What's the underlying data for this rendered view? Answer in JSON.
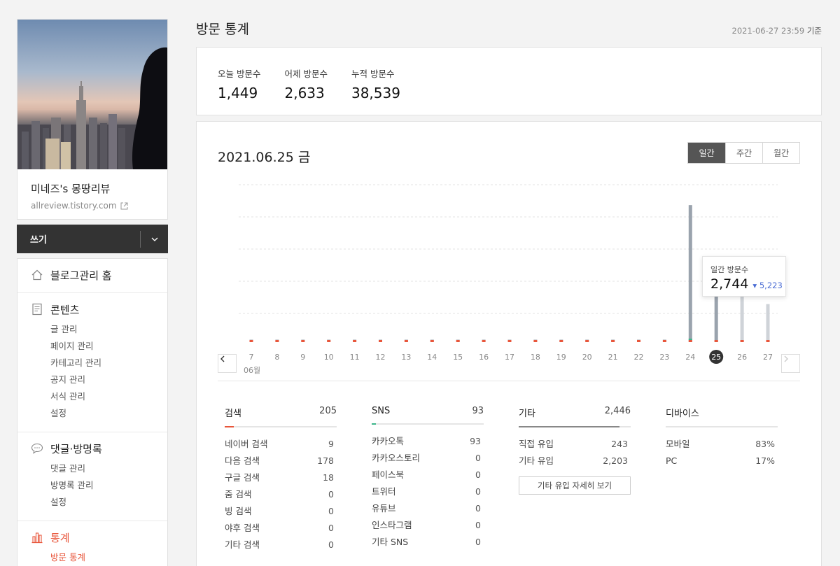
{
  "sidebar": {
    "blog_name": "미네즈's 몽땅리뷰",
    "blog_url": "allreview.tistory.com",
    "write_label": "쓰기",
    "groups": [
      {
        "title": "블로그관리 홈",
        "icon": "home-icon",
        "items": []
      },
      {
        "title": "콘텐츠",
        "icon": "document-icon",
        "items": [
          "글 관리",
          "페이지 관리",
          "카테고리 관리",
          "공지 관리",
          "서식 관리",
          "설정"
        ]
      },
      {
        "title": "댓글·방명록",
        "icon": "speech-bubble-icon",
        "items": [
          "댓글 관리",
          "방명록 관리",
          "설정"
        ]
      },
      {
        "title": "통계",
        "icon": "bar-chart-icon",
        "items": [
          "방문 통계"
        ]
      }
    ]
  },
  "header": {
    "title": "방문 통계",
    "timestamp": "2021-06-27 23:59",
    "timestamp_suffix": "기준"
  },
  "summary": [
    {
      "label": "오늘 방문수",
      "value": "1,449"
    },
    {
      "label": "어제 방문수",
      "value": "2,633"
    },
    {
      "label": "누적 방문수",
      "value": "38,539"
    }
  ],
  "panel": {
    "date": "2021.06.25 금",
    "toggle": [
      "일간",
      "주간",
      "월간"
    ],
    "month_label": "06월",
    "tooltip": {
      "label": "일간 방문수",
      "value": "2,744",
      "change": "5,223"
    }
  },
  "chart_data": {
    "type": "bar",
    "categories": [
      "7",
      "8",
      "9",
      "10",
      "11",
      "12",
      "13",
      "14",
      "15",
      "16",
      "17",
      "18",
      "19",
      "20",
      "21",
      "22",
      "23",
      "24",
      "25",
      "26",
      "27"
    ],
    "values": [
      55,
      40,
      30,
      30,
      30,
      25,
      30,
      35,
      40,
      25,
      30,
      45,
      35,
      45,
      50,
      45,
      45,
      5223,
      2744,
      2633,
      1449
    ],
    "selected": "25",
    "ylim": [
      0,
      6000
    ],
    "grid": true
  },
  "sources": [
    {
      "title": "검색",
      "total": "205",
      "accent": "#e8563b",
      "accent_fraction": 0.08,
      "rows": [
        [
          "네이버 검색",
          "9"
        ],
        [
          "다음 검색",
          "178"
        ],
        [
          "구글 검색",
          "18"
        ],
        [
          "줌 검색",
          "0"
        ],
        [
          "빙 검색",
          "0"
        ],
        [
          "야후 검색",
          "0"
        ],
        [
          "기타 검색",
          "0"
        ]
      ]
    },
    {
      "title": "SNS",
      "total": "93",
      "accent": "#3cb58a",
      "accent_fraction": 0.04,
      "rows": [
        [
          "카카오톡",
          "93"
        ],
        [
          "카카오스토리",
          "0"
        ],
        [
          "페이스북",
          "0"
        ],
        [
          "트위터",
          "0"
        ],
        [
          "유튜브",
          "0"
        ],
        [
          "인스타그램",
          "0"
        ],
        [
          "기타 SNS",
          "0"
        ]
      ]
    },
    {
      "title": "기타",
      "total": "2,446",
      "accent": "#888888",
      "accent_fraction": 0.9,
      "rows": [
        [
          "직접 유입",
          "243"
        ],
        [
          "기타 유입",
          "2,203"
        ]
      ],
      "button": "기타 유입 자세히 보기"
    },
    {
      "title": "디바이스",
      "total": "",
      "accent": "#e5e5e5",
      "accent_fraction": 0,
      "rows": [
        [
          "모바일",
          "83%"
        ],
        [
          "PC",
          "17%"
        ]
      ]
    }
  ]
}
